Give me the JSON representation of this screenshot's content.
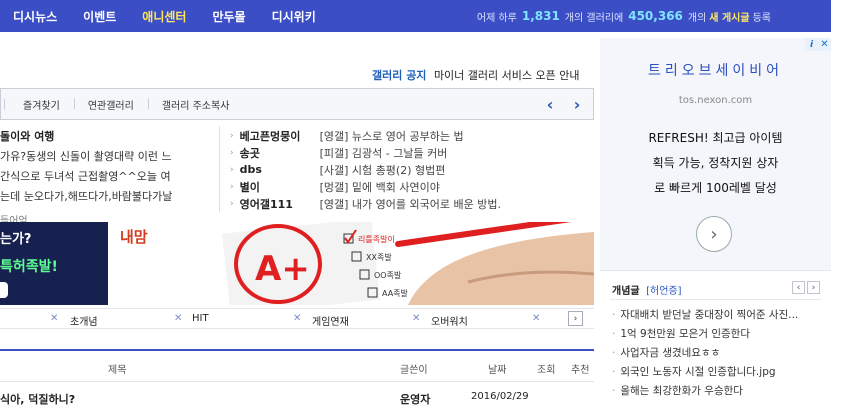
{
  "nav": {
    "items": [
      "디시뉴스",
      "이벤트",
      "애니센터",
      "만두몰",
      "디시위키"
    ],
    "active_index": 2
  },
  "stats": {
    "prefix": "어제 하루",
    "count1": "1,831",
    "mid": "개의 갤러리에",
    "count2": "450,366",
    "suffix_pre": "개의",
    "highlight": "새 게시글",
    "suffix": "등록"
  },
  "notice": {
    "tag": "갤러리 공지",
    "text": "마이너 갤러리 서비스 오픈 안내"
  },
  "toolbar": {
    "items": [
      "즐겨찾기",
      "연관갤러리",
      "갤러리 주소복사"
    ],
    "prev": "‹",
    "next": "›"
  },
  "content_left": {
    "title": "돌이와 여행",
    "lines": [
      "가유?동생의 신돌이 촬영대략 이런 느",
      "간식으로 두녀석 근접촬영^^오늘 여",
      "는데 눈오다가,해뜨다가,바람불다가날"
    ],
    "sub": "들어엄"
  },
  "content_right": {
    "rows": [
      {
        "name": "베고픈멍뭉이",
        "text": "[영갤] 뉴스로 영어 공부하는 법"
      },
      {
        "name": "송곳",
        "text": "[피갤] 김광석 - 그날들 커버"
      },
      {
        "name": "dbs",
        "text": "[사갤] 시험 총평(2) 형법편"
      },
      {
        "name": "별이",
        "text": "[멍갤] 밑에 백회 사연이야"
      },
      {
        "name": "영어갤111",
        "text": "[영갤] 내가 영어를 외국어로 배운 방법."
      }
    ]
  },
  "banner1": {
    "line1": "는가?",
    "line2": "특허족발!"
  },
  "banner2": {
    "logo": "내맘",
    "grade": "A+",
    "check1": "리틀족발이",
    "check2": "XX족발",
    "check3": "OO족발",
    "check4": "AA족발"
  },
  "tags": {
    "items": [
      "초개념",
      "HIT",
      "게임연재",
      "오버워치"
    ],
    "next": "›"
  },
  "board": {
    "headers": {
      "title": "제목",
      "writer": "글쓴이",
      "date": "날짜",
      "views": "조회",
      "recommend": "추천"
    },
    "row": {
      "title": "식아, 덕질하니?",
      "writer": "운영자",
      "date": "2016/02/29"
    }
  },
  "ad": {
    "title": "트리오브세이비어",
    "url": "tos.nexon.com",
    "body": [
      "REFRESH! 최고급 아이템",
      "획득 가능, 정착지원 상자",
      "로 빠르게 100레벨 달성"
    ],
    "info": "i",
    "close": "✕",
    "cta": "›"
  },
  "concept": {
    "title": "개념글",
    "sub": "[허언증]",
    "prev": "‹",
    "next": "›",
    "items": [
      "자대배치 받던날 중대장이 찍어준 사진...",
      "1억 9천만원 모은거 인증한다",
      "사업자금 생겼네요ㅎㅎ",
      "외국인 노동자 시절 인증합니다.jpg",
      "올해는 최강한화가 우승한다"
    ]
  }
}
